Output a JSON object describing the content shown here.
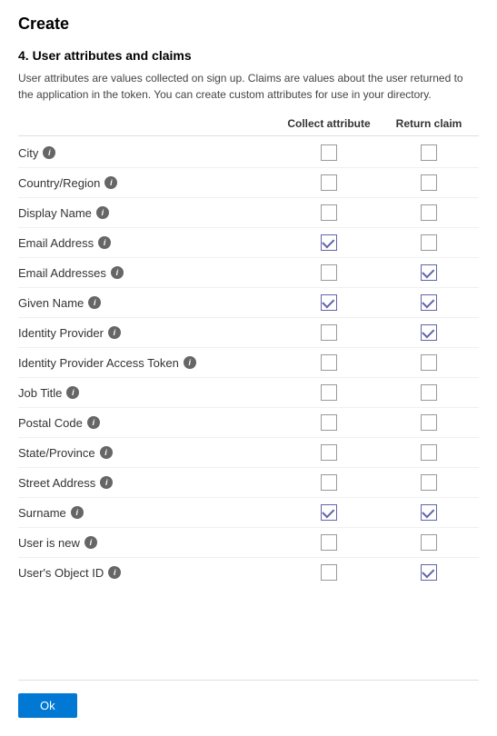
{
  "page": {
    "title": "Create",
    "section_number": "4. User attributes and claims",
    "description": "User attributes are values collected on sign up. Claims are values about the user returned to the application in the token. You can create custom attributes for use in your directory.",
    "col_collect": "Collect attribute",
    "col_return": "Return claim"
  },
  "attributes": [
    {
      "id": "city",
      "name": "City",
      "collect": false,
      "return": false
    },
    {
      "id": "country_region",
      "name": "Country/Region",
      "collect": false,
      "return": false
    },
    {
      "id": "display_name",
      "name": "Display Name",
      "collect": false,
      "return": false
    },
    {
      "id": "email_address",
      "name": "Email Address",
      "collect": true,
      "return": false
    },
    {
      "id": "email_addresses",
      "name": "Email Addresses",
      "collect": false,
      "return": true
    },
    {
      "id": "given_name",
      "name": "Given Name",
      "collect": true,
      "return": true
    },
    {
      "id": "identity_provider",
      "name": "Identity Provider",
      "collect": false,
      "return": true
    },
    {
      "id": "identity_provider_access_token",
      "name": "Identity Provider Access Token",
      "collect": false,
      "return": false
    },
    {
      "id": "job_title",
      "name": "Job Title",
      "collect": false,
      "return": false
    },
    {
      "id": "postal_code",
      "name": "Postal Code",
      "collect": false,
      "return": false
    },
    {
      "id": "state_province",
      "name": "State/Province",
      "collect": false,
      "return": false
    },
    {
      "id": "street_address",
      "name": "Street Address",
      "collect": false,
      "return": false
    },
    {
      "id": "surname",
      "name": "Surname",
      "collect": true,
      "return": true
    },
    {
      "id": "user_is_new",
      "name": "User is new",
      "collect": false,
      "return": false
    },
    {
      "id": "users_object_id",
      "name": "User's Object ID",
      "collect": false,
      "return": true
    }
  ],
  "footer": {
    "ok_label": "Ok"
  }
}
